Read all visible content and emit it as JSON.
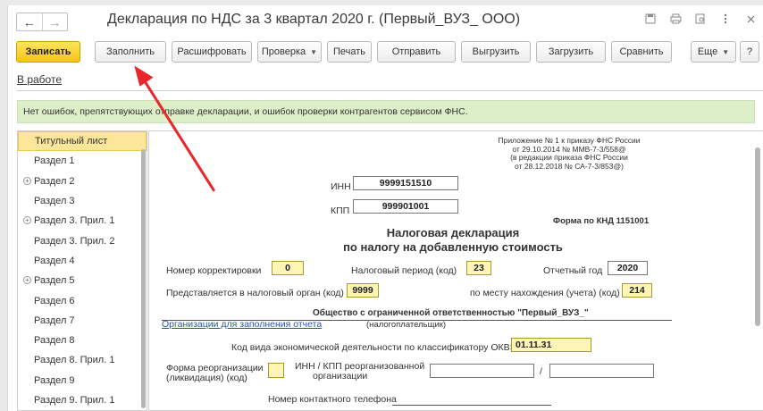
{
  "window": {
    "title": "Декларация по НДС за 3 квартал 2020 г. (Первый_ВУЗ_ ООО)",
    "nav_back": "←",
    "nav_forward": "→",
    "tool_icons": [
      "save-icon",
      "print-icon",
      "preview-icon",
      "more-icon",
      "close-icon"
    ]
  },
  "toolbar": {
    "save": "Записать",
    "fill": "Заполнить",
    "decode": "Расшифровать",
    "check": "Проверка",
    "print": "Печать",
    "send": "Отправить",
    "upload": "Выгрузить",
    "load": "Загрузить",
    "compare": "Сравнить",
    "more": "Еще",
    "help": "?"
  },
  "status": {
    "label": "В работе"
  },
  "info_bar": {
    "text": "Нет ошибок, препятствующих отправке декларации, и ошибок проверки контрагентов сервисом ФНС."
  },
  "sections": [
    {
      "label": "Титульный лист",
      "selected": true,
      "expandable": false
    },
    {
      "label": "Раздел 1",
      "selected": false,
      "expandable": false
    },
    {
      "label": "Раздел 2",
      "selected": false,
      "expandable": true
    },
    {
      "label": "Раздел 3",
      "selected": false,
      "expandable": false
    },
    {
      "label": "Раздел 3. Прил. 1",
      "selected": false,
      "expandable": true
    },
    {
      "label": "Раздел 3. Прил. 2",
      "selected": false,
      "expandable": false
    },
    {
      "label": "Раздел 4",
      "selected": false,
      "expandable": false
    },
    {
      "label": "Раздел 5",
      "selected": false,
      "expandable": true
    },
    {
      "label": "Раздел 6",
      "selected": false,
      "expandable": false
    },
    {
      "label": "Раздел 7",
      "selected": false,
      "expandable": false
    },
    {
      "label": "Раздел 8",
      "selected": false,
      "expandable": false
    },
    {
      "label": "Раздел 8. Прил. 1",
      "selected": false,
      "expandable": false
    },
    {
      "label": "Раздел 9",
      "selected": false,
      "expandable": false
    },
    {
      "label": "Раздел 9. Прил. 1",
      "selected": false,
      "expandable": false
    }
  ],
  "form": {
    "appendix": [
      "Приложение № 1 к приказу ФНС России",
      "от 29.10.2014 № ММВ-7-3/558@",
      "(в редакции приказа ФНС России",
      "от 28.12.2018 № СА-7-3/853@)"
    ],
    "inn_label": "ИНН",
    "inn_value": "9999151510",
    "kpp_label": "КПП",
    "kpp_value": "999901001",
    "knd": "Форма по КНД 1151001",
    "title_line1": "Налоговая декларация",
    "title_line2": "по налогу на добавленную стоимость",
    "correction_label": "Номер корректировки",
    "correction_value": "0",
    "period_label": "Налоговый период (код)",
    "period_value": "23",
    "year_label": "Отчетный год",
    "year_value": "2020",
    "authority_label": "Представляется в налоговый орган (код)",
    "authority_value": "9999",
    "location_label": "по месту нахождения (учета) (код)",
    "location_value": "214",
    "org_name": "Общество с ограниченной ответственностью \"Первый_ВУЗ_\"",
    "org_link": "Организации для заполнения отчета",
    "taxpayer_caption": "(налогоплательщик)",
    "okved_label": "Код вида экономической деятельности по классификатору ОКВЭД",
    "okved_value": "01.11.31",
    "reorg_form_label_1": "Форма реорганизации",
    "reorg_form_label_2": "(ликвидация) (код)",
    "reorg_inn_label_1": "ИНН / КПП реорганизованной",
    "reorg_inn_label_2": "организации",
    "slash": "/",
    "phone_label": "Номер контактного телефона"
  },
  "colors": {
    "primary_button": "#f5c518",
    "selected_item": "#fbe69a",
    "info_bar": "#dcefc9",
    "input_highlight": "#fdf5b5",
    "annotation_arrow": "#e8262b"
  }
}
